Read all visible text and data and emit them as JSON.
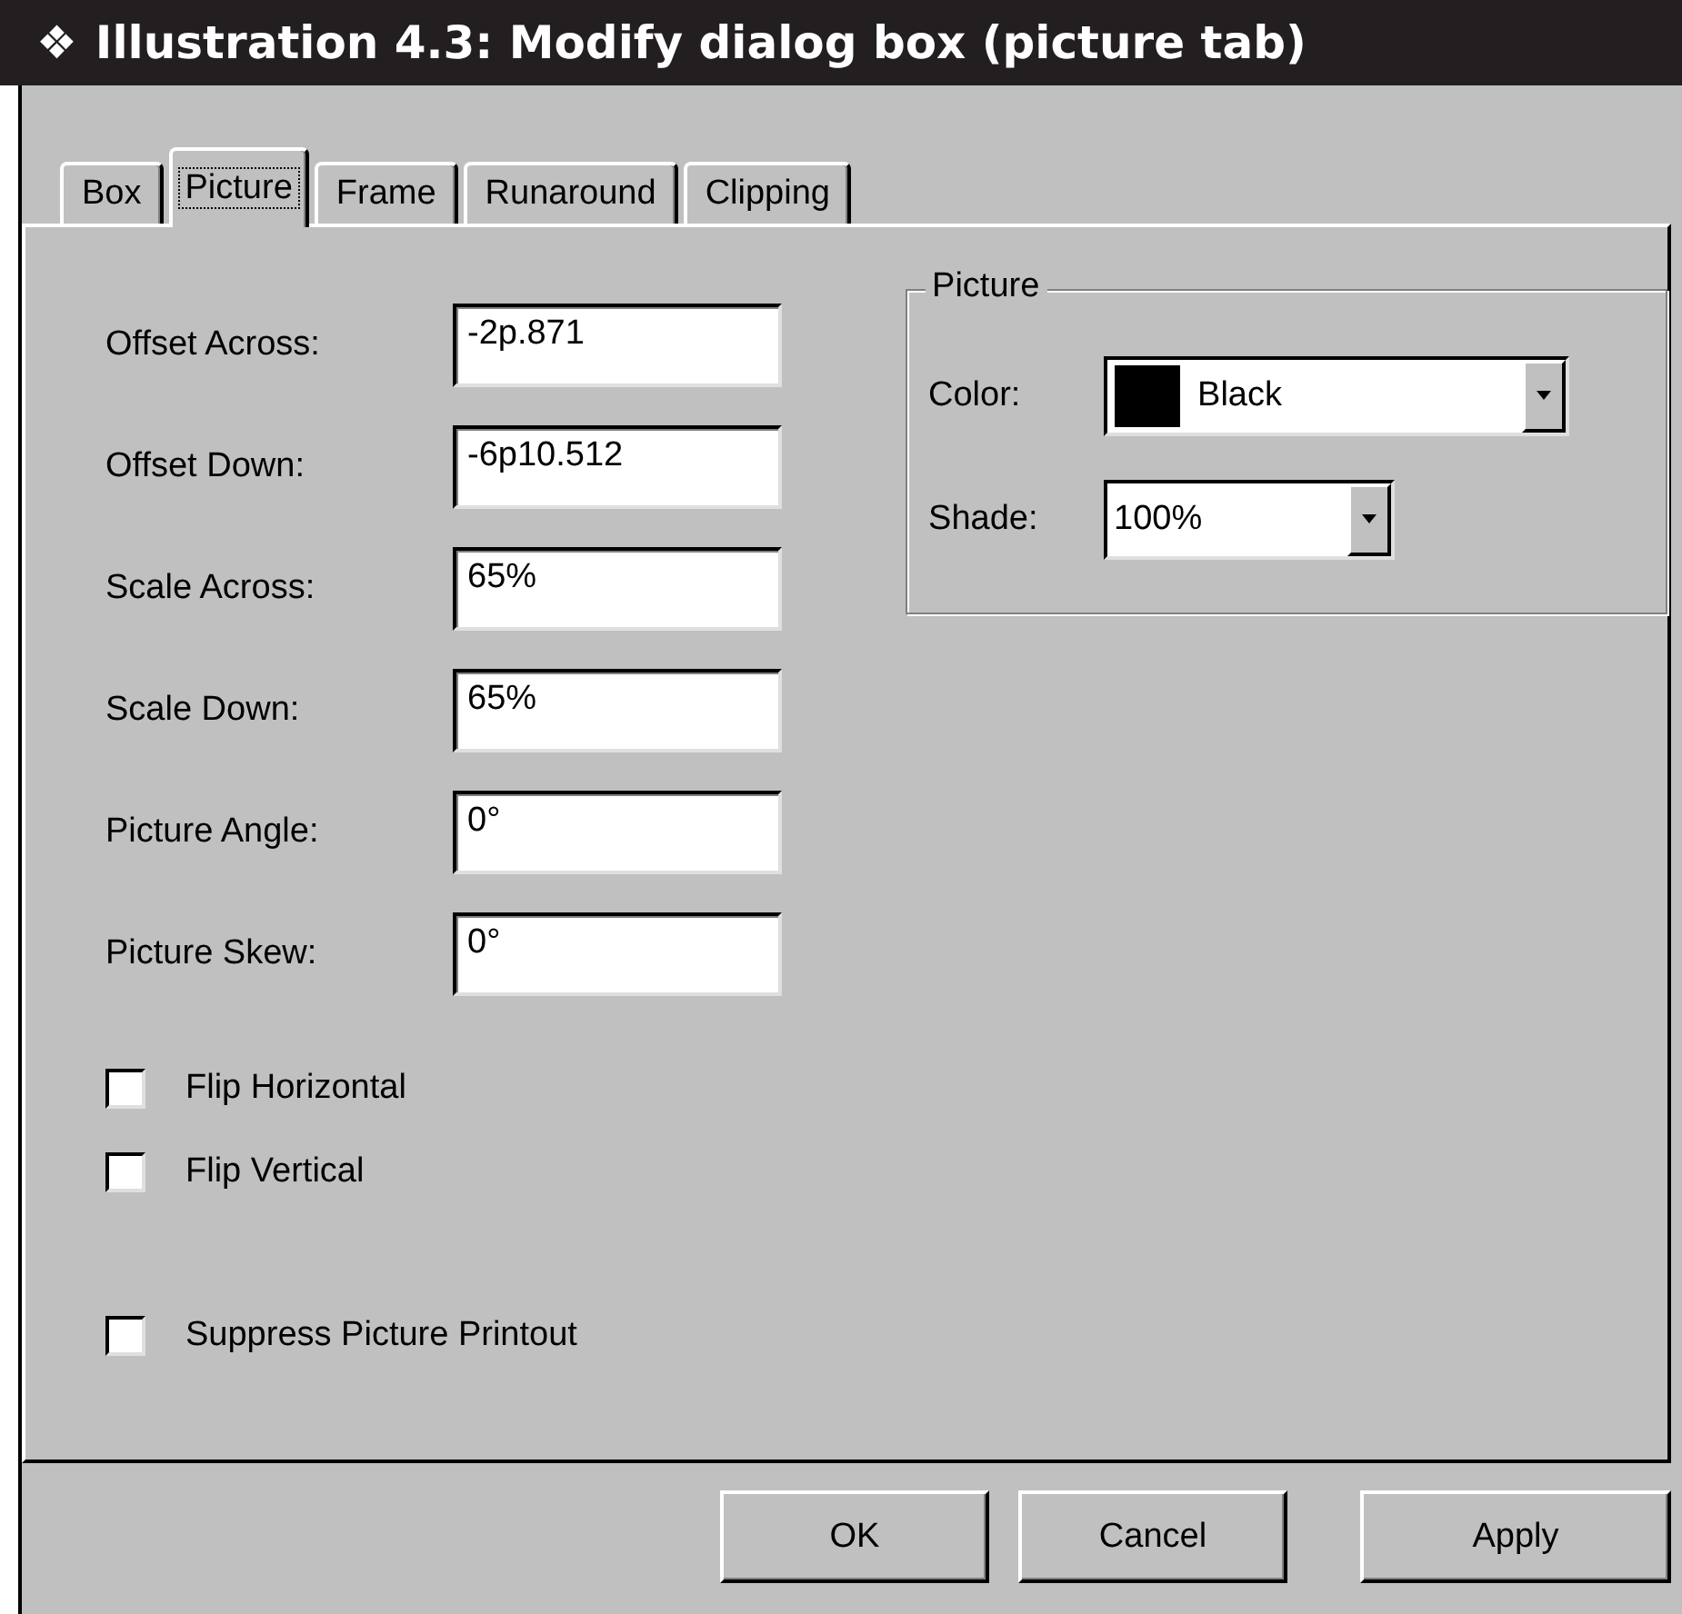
{
  "heading": {
    "icon": "❖",
    "title": "Illustration 4.3: Modify dialog box (picture tab)"
  },
  "tabs": [
    {
      "label": "Box",
      "selected": false
    },
    {
      "label": "Picture",
      "selected": true
    },
    {
      "label": "Frame",
      "selected": false
    },
    {
      "label": "Runaround",
      "selected": false
    },
    {
      "label": "Clipping",
      "selected": false
    }
  ],
  "fields": [
    {
      "label": "Offset Across:",
      "value": "-2p.871"
    },
    {
      "label": "Offset Down:",
      "value": "-6p10.512"
    },
    {
      "label": "Scale Across:",
      "value": "65%"
    },
    {
      "label": "Scale Down:",
      "value": "65%"
    },
    {
      "label": "Picture Angle:",
      "value": "0°"
    },
    {
      "label": "Picture Skew:",
      "value": "0°"
    }
  ],
  "checkboxes": [
    {
      "label": "Flip Horizontal",
      "checked": false
    },
    {
      "label": "Flip Vertical",
      "checked": false
    },
    {
      "label": "Suppress Picture Printout",
      "checked": false
    }
  ],
  "picture_group": {
    "title": "Picture",
    "color": {
      "label": "Color:",
      "value": "Black",
      "color": "#000000"
    },
    "shade": {
      "label": "Shade:",
      "value": "100%"
    }
  },
  "buttons": [
    {
      "label": "OK"
    },
    {
      "label": "Cancel"
    },
    {
      "label": "Apply"
    }
  ]
}
